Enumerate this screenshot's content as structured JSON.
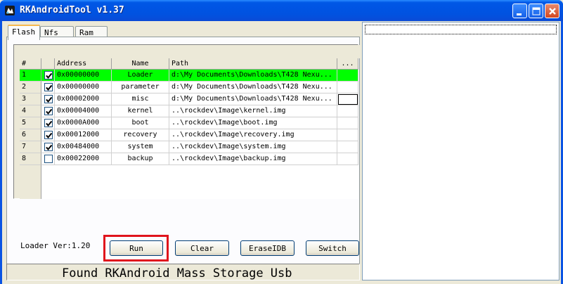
{
  "window": {
    "title": "RKAndroidTool v1.37"
  },
  "tabs": [
    {
      "label": "Flash",
      "active": true
    },
    {
      "label": "Nfs",
      "active": false
    },
    {
      "label": "Ram",
      "active": false
    }
  ],
  "grid": {
    "columns": [
      "#",
      "",
      "Address",
      "Name",
      "Path",
      "..."
    ],
    "rows": [
      {
        "num": "1",
        "checked": true,
        "address": "0x00000000",
        "name": "Loader",
        "path": "d:\\My Documents\\Downloads\\T428 Nexu...",
        "selected": true
      },
      {
        "num": "2",
        "checked": true,
        "address": "0x00000000",
        "name": "parameter",
        "path": "d:\\My Documents\\Downloads\\T428 Nexu...",
        "selected": false
      },
      {
        "num": "3",
        "checked": true,
        "address": "0x00002000",
        "name": "misc",
        "path": "d:\\My Documents\\Downloads\\T428 Nexu...",
        "selected": false
      },
      {
        "num": "4",
        "checked": true,
        "address": "0x00004000",
        "name": "kernel",
        "path": "..\\rockdev\\Image\\kernel.img",
        "selected": false
      },
      {
        "num": "5",
        "checked": true,
        "address": "0x0000A000",
        "name": "boot",
        "path": "..\\rockdev\\Image\\boot.img",
        "selected": false
      },
      {
        "num": "6",
        "checked": true,
        "address": "0x00012000",
        "name": "recovery",
        "path": "..\\rockdev\\Image\\recovery.img",
        "selected": false
      },
      {
        "num": "7",
        "checked": true,
        "address": "0x00484000",
        "name": "system",
        "path": "..\\rockdev\\Image\\system.img",
        "selected": false
      },
      {
        "num": "8",
        "checked": false,
        "address": "0x00022000",
        "name": "backup",
        "path": "..\\rockdev\\Image\\backup.img",
        "selected": false
      }
    ]
  },
  "loader_version": "Loader Ver:1.20",
  "buttons": {
    "run": "Run",
    "clear": "Clear",
    "erase_idb": "EraseIDB",
    "switch": "Switch"
  },
  "status": "Found RKAndroid Mass Storage Usb",
  "colors": {
    "titlebar": "#0054e3",
    "selected_row": "#00ff00",
    "highlight": "#e0141c",
    "face": "#ece9d8"
  },
  "icons": {
    "app": "rockchip-app-icon",
    "minimize": "minimize-icon",
    "maximize": "maximize-icon",
    "close": "close-icon",
    "check": "checkmark-icon"
  }
}
